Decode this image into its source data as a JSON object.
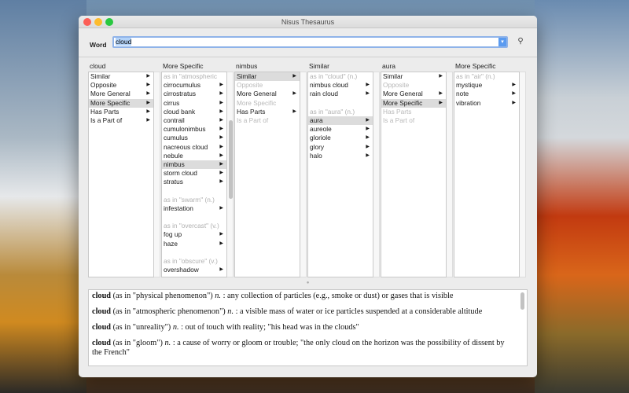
{
  "window": {
    "title": "Nisus Thesaurus"
  },
  "word": {
    "label": "Word",
    "value": "cloud"
  },
  "columns": [
    {
      "header": "cloud",
      "items": [
        {
          "t": "Similar",
          "a": 1
        },
        {
          "t": "Opposite",
          "a": 1
        },
        {
          "t": "More General",
          "a": 1
        },
        {
          "t": "More Specific",
          "a": 1,
          "s": 1
        },
        {
          "t": "Has Parts",
          "a": 1
        },
        {
          "t": "Is a Part of",
          "a": 1
        }
      ]
    },
    {
      "header": "More Specific",
      "scroll": true,
      "items": [
        {
          "t": "as in \"atmospheric",
          "h": 1
        },
        {
          "t": "cirrocumulus",
          "a": 1
        },
        {
          "t": "cirrostratus",
          "a": 1
        },
        {
          "t": "cirrus",
          "a": 1
        },
        {
          "t": "cloud bank",
          "a": 1
        },
        {
          "t": "contrail",
          "a": 1
        },
        {
          "t": "cumulonimbus",
          "a": 1
        },
        {
          "t": "cumulus",
          "a": 1
        },
        {
          "t": "nacreous cloud",
          "a": 1
        },
        {
          "t": "nebule",
          "a": 1
        },
        {
          "t": "nimbus",
          "a": 1,
          "s": 1
        },
        {
          "t": "storm cloud",
          "a": 1
        },
        {
          "t": "stratus",
          "a": 1
        },
        {
          "t": ""
        },
        {
          "t": "as in \"swarm\" (n.)",
          "h": 1
        },
        {
          "t": "infestation",
          "a": 1
        },
        {
          "t": ""
        },
        {
          "t": "as in \"overcast\" (v.)",
          "h": 1
        },
        {
          "t": "fog up",
          "a": 1
        },
        {
          "t": "haze",
          "a": 1
        },
        {
          "t": ""
        },
        {
          "t": "as in \"obscure\" (v.)",
          "h": 1
        },
        {
          "t": "overshadow",
          "a": 1
        }
      ]
    },
    {
      "header": "nimbus",
      "items": [
        {
          "t": "Similar",
          "a": 1,
          "s": 1
        },
        {
          "t": "Opposite",
          "d": 1
        },
        {
          "t": "More General",
          "a": 1
        },
        {
          "t": "More Specific",
          "d": 1
        },
        {
          "t": "Has Parts",
          "a": 1
        },
        {
          "t": "Is a Part of",
          "d": 1
        }
      ]
    },
    {
      "header": "Similar",
      "items": [
        {
          "t": "as in \"cloud\" (n.)",
          "h": 1
        },
        {
          "t": "nimbus cloud",
          "a": 1
        },
        {
          "t": "rain cloud",
          "a": 1
        },
        {
          "t": ""
        },
        {
          "t": "as in \"aura\" (n.)",
          "h": 1
        },
        {
          "t": "aura",
          "a": 1,
          "s": 1
        },
        {
          "t": "aureole",
          "a": 1
        },
        {
          "t": "gloriole",
          "a": 1
        },
        {
          "t": "glory",
          "a": 1
        },
        {
          "t": "halo",
          "a": 1
        }
      ]
    },
    {
      "header": "aura",
      "items": [
        {
          "t": "Similar",
          "a": 1
        },
        {
          "t": "Opposite",
          "d": 1
        },
        {
          "t": "More General",
          "a": 1
        },
        {
          "t": "More Specific",
          "a": 1,
          "s": 1
        },
        {
          "t": "Has Parts",
          "d": 1
        },
        {
          "t": "Is a Part of",
          "d": 1
        }
      ]
    },
    {
      "header": "More Specific",
      "items": [
        {
          "t": "as in \"air\" (n.)",
          "h": 1
        },
        {
          "t": "mystique",
          "a": 1
        },
        {
          "t": "note",
          "a": 1
        },
        {
          "t": "vibration",
          "a": 1
        }
      ]
    }
  ],
  "definitions": [
    {
      "word": "cloud",
      "sense": "(as in \"physical phenomenon\")",
      "pos": "n.",
      "text": ": any collection of particles (e.g., smoke or dust) or gases that is visible"
    },
    {
      "word": "cloud",
      "sense": "(as in \"atmospheric phenomenon\")",
      "pos": "n.",
      "text": ": a visible mass of water or ice particles suspended at a considerable altitude"
    },
    {
      "word": "cloud",
      "sense": "(as in \"unreality\")",
      "pos": "n.",
      "text": ": out of touch with reality; \"his head was in the clouds\""
    },
    {
      "word": "cloud",
      "sense": "(as in \"gloom\")",
      "pos": "n.",
      "text": ": a cause of worry or gloom or trouble; \"the only cloud on the horizon was the possibility of dissent by the French\""
    }
  ],
  "colors": {
    "close": "#fc5f57",
    "minimize": "#fdbc2e",
    "zoom": "#29c840",
    "selection": "#dcdcdc",
    "focus": "#8fb3e9"
  }
}
